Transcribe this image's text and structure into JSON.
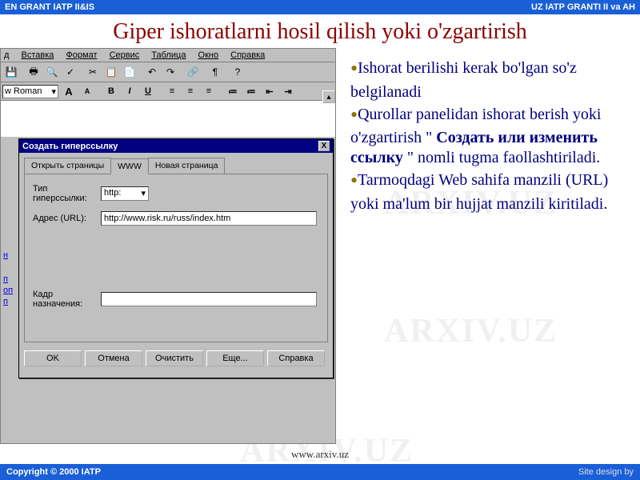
{
  "header": {
    "left": "EN GRANT IATP II&IS",
    "right": "UZ  IATP GRANTI II va AH"
  },
  "title": "Giper ishoratlarni hosil qilish yoki o'zgartirish",
  "watermark": "ARXIV.UZ",
  "app": {
    "menu": {
      "vstavka": "Вставка",
      "format": "Формат",
      "servis": "Сервис",
      "tablitsa": "Таблица",
      "okno": "Окно",
      "spravka": "Справка",
      "d": "д"
    },
    "font_name": "w Roman",
    "format_buttons": {
      "bold": "B",
      "italic": "I",
      "underline": "U",
      "bigA": "A",
      "smallA": "A"
    },
    "doc_links": {
      "l1": "н",
      "l2": "п",
      "l3": "оп",
      "l4": "п"
    }
  },
  "dialog": {
    "title": "Создать гиперссылку",
    "close": "X",
    "tabs": {
      "open": "Открыть страницы",
      "www": "WWW",
      "newpage": "Новая страница"
    },
    "labels": {
      "type": "Тип гиперссылки:",
      "url": "Адрес (URL):",
      "anchor": "Кадр назначения:"
    },
    "values": {
      "type": "http:",
      "url": "http://www.risk.ru/russ/index.htm",
      "anchor": ""
    },
    "buttons": {
      "ok": "OK",
      "cancel": "Отмена",
      "clear": "Очистить",
      "more": "Еще...",
      "help": "Справка"
    }
  },
  "bullets": {
    "b1": "Ishorat berilishi kerak bo'lgan so'z belgilanadi",
    "b2a": "Qurollar panelidan ishorat berish yoki o'zgartirish \" ",
    "b2bold": "Создать или изменить ссылку",
    "b2b": " \" nomli tugma faollashtiriladi.",
    "b3": "Tarmoqdagi Web sahifa manzili (URL) yoki ma'lum bir hujjat manzili kiritiladi."
  },
  "bottom_url": "www.arxiv.uz",
  "footer": {
    "copyright": "Copyright © 2000 IATP",
    "design": "Site design by"
  }
}
